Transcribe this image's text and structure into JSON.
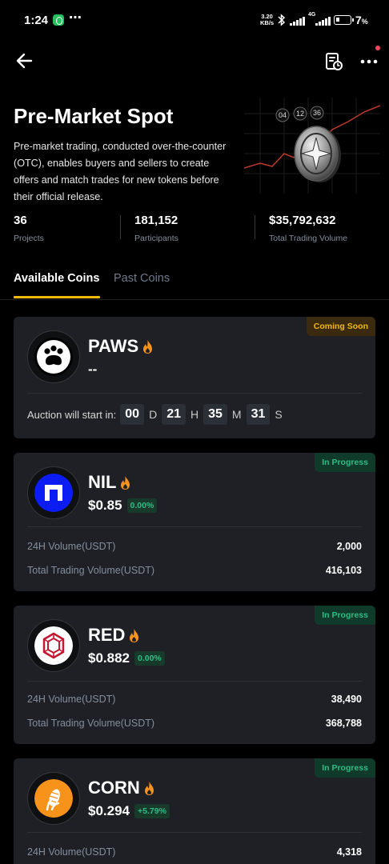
{
  "status_bar": {
    "time": "1:24",
    "more": "⋯",
    "net_speed_value": "3.20",
    "net_speed_unit": "KB/s",
    "network": "4G",
    "battery": "7"
  },
  "header": {
    "back_icon": "arrow-left-icon",
    "history_icon": "order-history-icon",
    "more_icon": "more-dots-icon"
  },
  "hero": {
    "title": "Pre-Market Spot",
    "description": "Pre-market trading, conducted over-the-counter (OTC), enables buyers and sellers to create offers and match trades for new tokens before their official release.",
    "art_labels": [
      "04",
      "12",
      "36"
    ],
    "stats": [
      {
        "value": "36",
        "label": "Projects"
      },
      {
        "value": "181,152",
        "label": "Participants"
      },
      {
        "value": "$35,792,632",
        "label": "Total Trading Volume"
      }
    ]
  },
  "tabs": {
    "available": "Available Coins",
    "past": "Past Coins"
  },
  "coins": [
    {
      "name": "PAWS",
      "status": "Coming Soon",
      "price": "--",
      "auction_label": "Auction will start in:",
      "countdown": {
        "d": "00",
        "d_unit": "D",
        "h": "21",
        "h_unit": "H",
        "m": "35",
        "m_unit": "M",
        "s": "31",
        "s_unit": "S"
      }
    },
    {
      "name": "NIL",
      "status": "In Progress",
      "price": "$0.85",
      "change": "0.00%",
      "vol24_label": "24H Volume(USDT)",
      "vol24": "2,000",
      "total_label": "Total Trading Volume(USDT)",
      "total": "416,103"
    },
    {
      "name": "RED",
      "status": "In Progress",
      "price": "$0.882",
      "change": "0.00%",
      "vol24_label": "24H Volume(USDT)",
      "vol24": "38,490",
      "total_label": "Total Trading Volume(USDT)",
      "total": "368,788"
    },
    {
      "name": "CORN",
      "status": "In Progress",
      "price": "$0.294",
      "change": "+5.79%",
      "vol24_label": "24H Volume(USDT)",
      "vol24": "4,318"
    }
  ],
  "colors": {
    "accent": "#f0b90b",
    "positive": "#2ebd85",
    "card_bg": "#1e2026",
    "muted": "#848e9c"
  }
}
